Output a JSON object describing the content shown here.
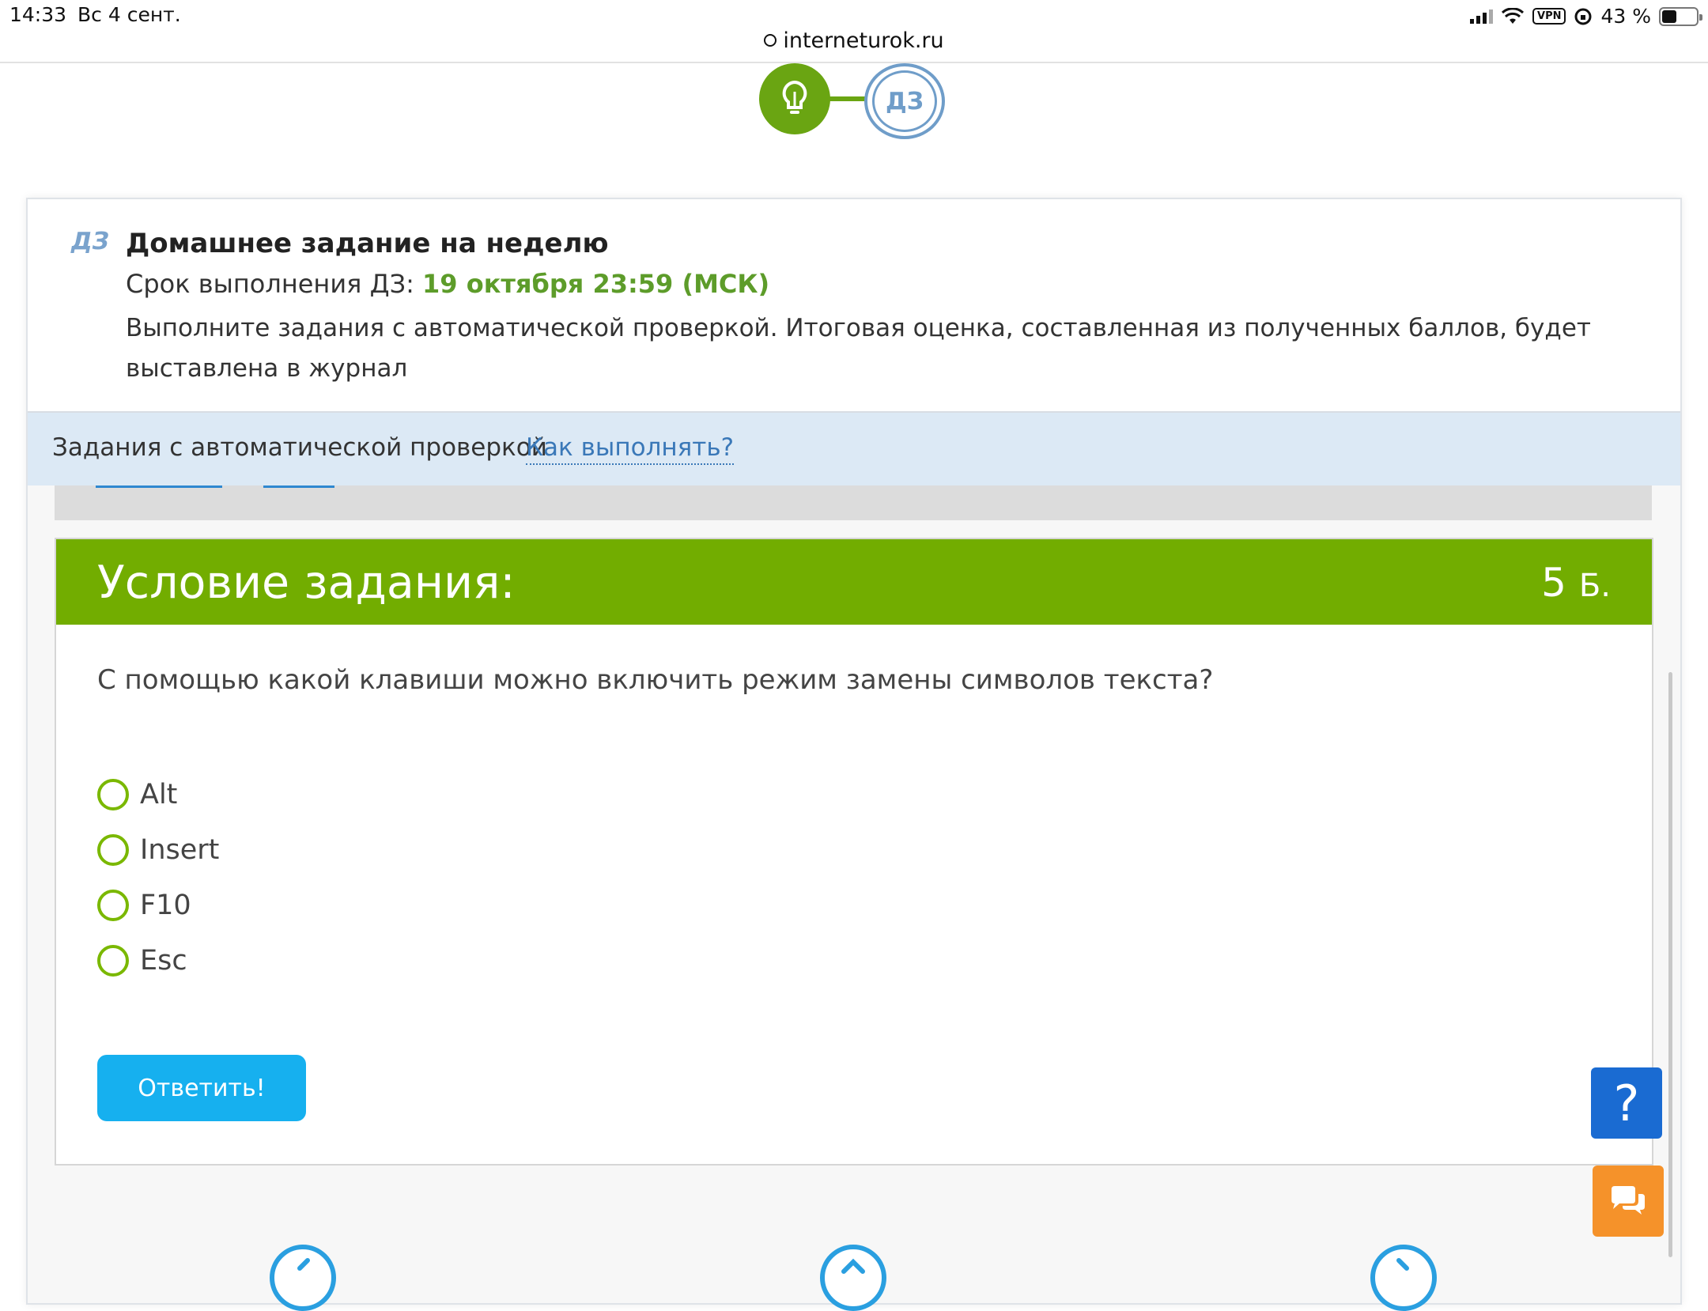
{
  "status_bar": {
    "time": "14:33",
    "date": "Вс 4 сент.",
    "url": "interneturok.ru",
    "vpn_label": "VPN",
    "battery": "43 %"
  },
  "steps": {
    "current_label": "ДЗ"
  },
  "homework": {
    "icon_label": "ДЗ",
    "title": "Домашнее задание на неделю",
    "deadline_prefix": "Срок выполнения ДЗ: ",
    "deadline_date": "19 октября 23:59 (МСК)",
    "description": "Выполните задания с автоматической проверкой. Итоговая оценка, составленная из полученных баллов, будет выставлена в журнал"
  },
  "auto_check": {
    "label": "Задания с автоматической проверкой",
    "how_link": "Как выполнять?"
  },
  "task": {
    "header": "Условие задания:",
    "points_value": "5",
    "points_unit": "Б.",
    "question": "С помощью какой клавиши можно включить режим замены символов текста?",
    "options": [
      "Alt",
      "Insert",
      "F10",
      "Esc"
    ],
    "answer_button": "Ответить!"
  },
  "floating": {
    "help_label": "?"
  },
  "colors": {
    "accent_green": "#72ad00",
    "button_blue": "#16b0ef",
    "help_blue": "#1a6bd2",
    "chat_orange": "#f5922a",
    "info_bar": "#dce9f5"
  }
}
